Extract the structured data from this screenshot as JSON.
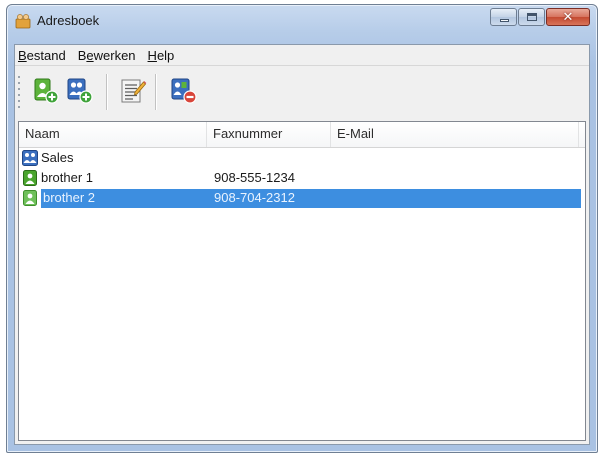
{
  "window": {
    "title": "Adresboek",
    "minimize_label": "",
    "maximize_label": "",
    "close_label": "✕"
  },
  "menu": {
    "items": [
      {
        "ul": "B",
        "rest": "estand"
      },
      {
        "pre": "B",
        "ul": "e",
        "rest": "werken"
      },
      {
        "ul": "H",
        "rest": "elp"
      }
    ]
  },
  "toolbar": {
    "buttons": [
      {
        "name": "add-contact-button",
        "icon": "add-contact-icon"
      },
      {
        "name": "add-group-button",
        "icon": "add-group-icon"
      },
      {
        "name": "edit-button",
        "icon": "edit-note-icon"
      },
      {
        "name": "delete-button",
        "icon": "delete-contact-icon"
      }
    ]
  },
  "list": {
    "columns": [
      "Naam",
      "Faxnummer",
      "E-Mail"
    ],
    "rows": [
      {
        "name": "Sales",
        "fax": "",
        "email": "",
        "type": "group",
        "icon": "group-icon",
        "selected": false
      },
      {
        "name": "brother 1",
        "fax": "908-555-1234",
        "email": "",
        "type": "contact",
        "icon": "contact-icon",
        "selected": false
      },
      {
        "name": "brother 2",
        "fax": "908-704-2312",
        "email": "",
        "type": "contact",
        "icon": "contact-icon",
        "selected": true
      }
    ]
  },
  "colors": {
    "selection": "#3d8ee0",
    "contact_icon_green": "#4aa52e",
    "group_icon_blue": "#3b6fbf"
  }
}
